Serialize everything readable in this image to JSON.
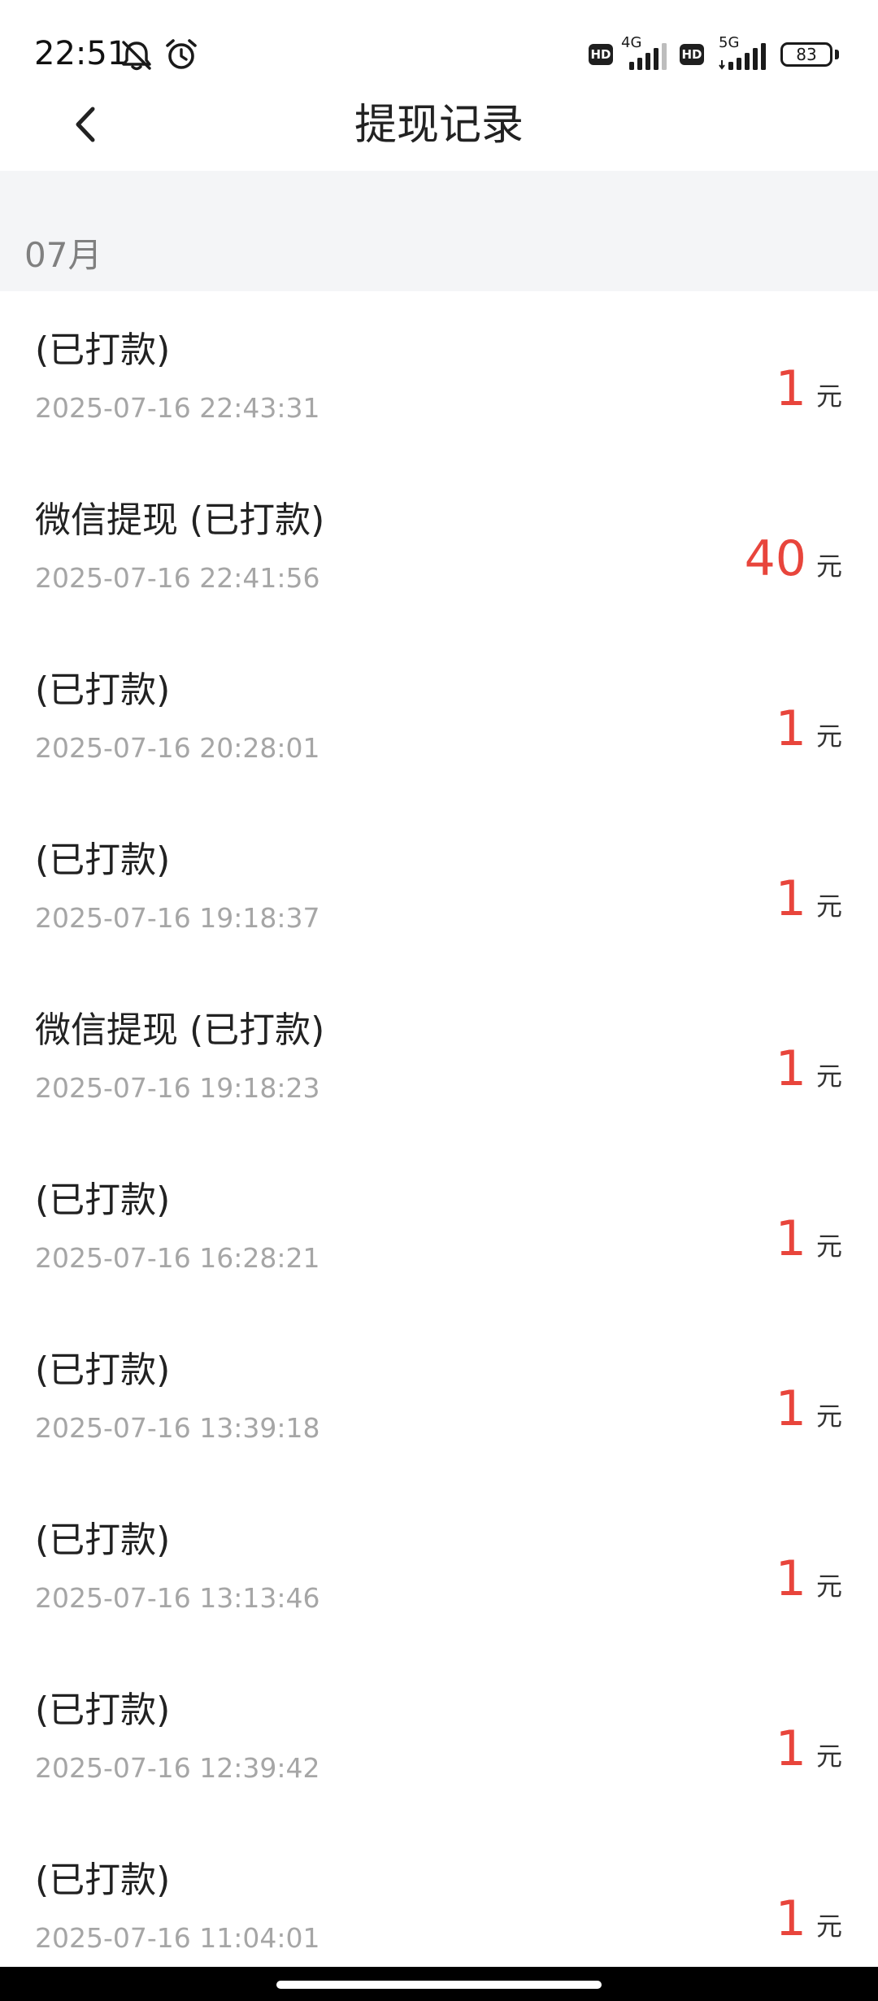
{
  "status_bar": {
    "time": "22:51",
    "icons": [
      "bell-mute-icon",
      "alarm-clock-icon"
    ],
    "sim1": {
      "badge": "HD",
      "network": "4G"
    },
    "sim2": {
      "badge": "HD",
      "network": "5G"
    },
    "battery": "83"
  },
  "header": {
    "back_icon": "chevron-left-icon",
    "title": "提现记录"
  },
  "section": {
    "label": "07月"
  },
  "records": [
    {
      "title": "(已打款)",
      "time": "2025-07-16 22:43:31",
      "amount": "1",
      "unit": "元"
    },
    {
      "title": "微信提现 (已打款)",
      "time": "2025-07-16 22:41:56",
      "amount": "40",
      "unit": "元"
    },
    {
      "title": "(已打款)",
      "time": "2025-07-16 20:28:01",
      "amount": "1",
      "unit": "元"
    },
    {
      "title": "(已打款)",
      "time": "2025-07-16 19:18:37",
      "amount": "1",
      "unit": "元"
    },
    {
      "title": "微信提现 (已打款)",
      "time": "2025-07-16 19:18:23",
      "amount": "1",
      "unit": "元"
    },
    {
      "title": "(已打款)",
      "time": "2025-07-16 16:28:21",
      "amount": "1",
      "unit": "元"
    },
    {
      "title": "(已打款)",
      "time": "2025-07-16 13:39:18",
      "amount": "1",
      "unit": "元"
    },
    {
      "title": "(已打款)",
      "time": "2025-07-16 13:13:46",
      "amount": "1",
      "unit": "元"
    },
    {
      "title": "(已打款)",
      "time": "2025-07-16 12:39:42",
      "amount": "1",
      "unit": "元"
    },
    {
      "title": "(已打款)",
      "time": "2025-07-16 11:04:01",
      "amount": "1",
      "unit": "元"
    }
  ],
  "colors": {
    "amount": "#e8453c",
    "section_bg": "#f4f5f7",
    "muted_text": "#a6a6a6"
  }
}
